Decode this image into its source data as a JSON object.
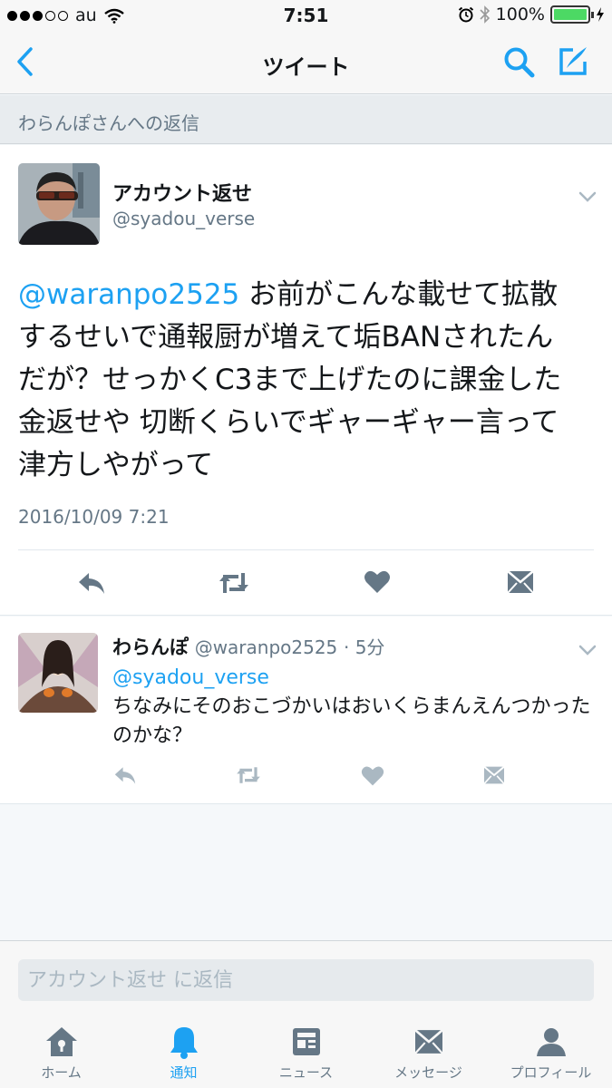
{
  "status_bar": {
    "carrier": "au",
    "time": "7:51",
    "battery": "100%"
  },
  "nav": {
    "title": "ツイート"
  },
  "reply_header": {
    "text": "わらんぽさんへの返信"
  },
  "main_tweet": {
    "name": "アカウント返せ",
    "handle": "@syadou_verse",
    "mention": "@waranpo2525",
    "text": " お前がこんな載せて拡散するせいで通報厨が増えて垢BANされたんだが？せっかくC3まで上げたのに課金した金返せや 切断くらいでギャーギャー言って津方しやがって",
    "timestamp": "2016/10/09 7:21"
  },
  "reply_tweet": {
    "name": "わらんぽ",
    "handle": "@waranpo2525",
    "time": "· 5分",
    "mention": "@syadou_verse",
    "text": "ちなみにそのおこづかいはおいくらまんえんつかったのかな？"
  },
  "compose": {
    "placeholder": "アカウント返せ に返信"
  },
  "tabs": [
    {
      "label": "ホーム",
      "icon": "home-icon"
    },
    {
      "label": "通知",
      "icon": "bell-icon",
      "active": true
    },
    {
      "label": "ニュース",
      "icon": "news-icon"
    },
    {
      "label": "メッセージ",
      "icon": "envelope-icon"
    },
    {
      "label": "プロフィール",
      "icon": "person-icon"
    }
  ],
  "colors": {
    "accent": "#1da1f2",
    "muted": "#657786",
    "icon_gray": "#8899a6",
    "battery": "#4cd964"
  }
}
